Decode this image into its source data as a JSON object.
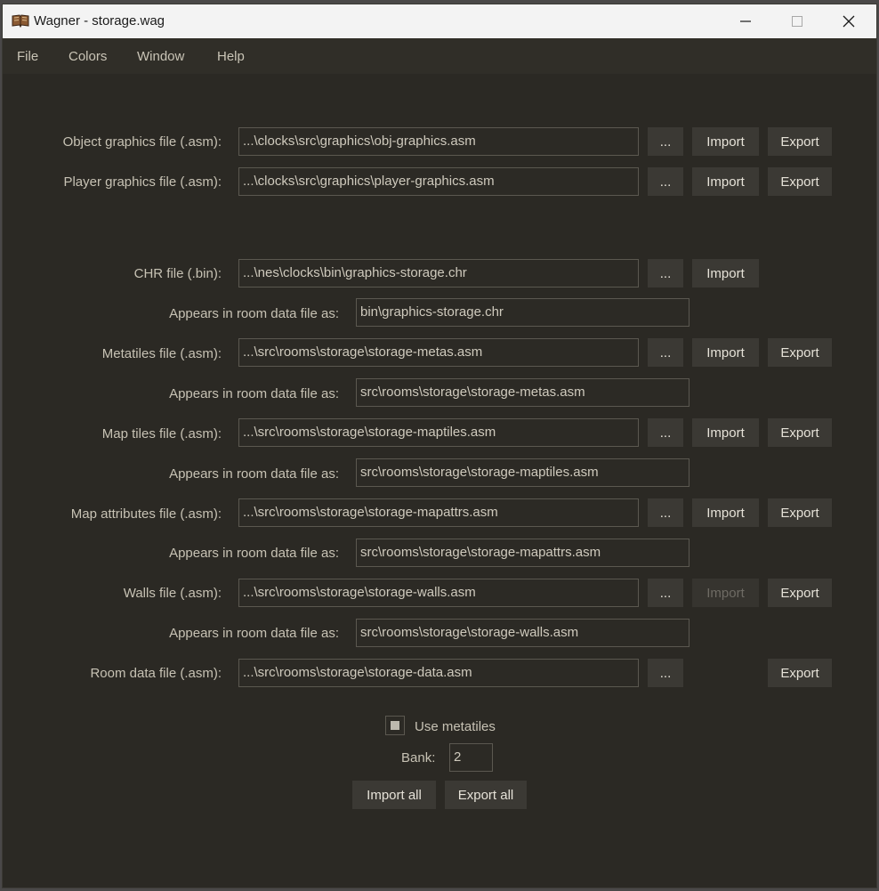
{
  "window": {
    "title": "Wagner - storage.wag"
  },
  "menu": [
    "File",
    "Colors",
    "Window",
    "Help"
  ],
  "buttons": {
    "browse": "...",
    "import": "Import",
    "export": "Export"
  },
  "rows": [
    {
      "label": "Object graphics file (.asm):",
      "value": "...\\clocks\\src\\graphics\\obj-graphics.asm"
    },
    {
      "label": "Player graphics file (.asm):",
      "value": "...\\clocks\\src\\graphics\\player-graphics.asm"
    },
    {
      "label": "CHR file (.bin):",
      "value": "...\\nes\\clocks\\bin\\graphics-storage.chr"
    },
    {
      "label": "Appears in room data file as:",
      "value": "bin\\graphics-storage.chr"
    },
    {
      "label": "Metatiles file (.asm):",
      "value": "...\\src\\rooms\\storage\\storage-metas.asm"
    },
    {
      "label": "Appears in room data file as:",
      "value": "src\\rooms\\storage\\storage-metas.asm"
    },
    {
      "label": "Map tiles file (.asm):",
      "value": "...\\src\\rooms\\storage\\storage-maptiles.asm"
    },
    {
      "label": "Appears in room data file as:",
      "value": "src\\rooms\\storage\\storage-maptiles.asm"
    },
    {
      "label": "Map attributes file (.asm):",
      "value": "...\\src\\rooms\\storage\\storage-mapattrs.asm"
    },
    {
      "label": "Appears in room data file as:",
      "value": "src\\rooms\\storage\\storage-mapattrs.asm"
    },
    {
      "label": "Walls file (.asm):",
      "value": "...\\src\\rooms\\storage\\storage-walls.asm"
    },
    {
      "label": "Appears in room data file as:",
      "value": "src\\rooms\\storage\\storage-walls.asm"
    },
    {
      "label": "Room data file (.asm):",
      "value": "...\\src\\rooms\\storage\\storage-data.asm"
    }
  ],
  "options": {
    "use_metatiles_label": "Use metatiles",
    "use_metatiles_checked": true,
    "bank_label": "Bank:",
    "bank_value": "2"
  },
  "actions": {
    "import_all": "Import all",
    "export_all": "Export all"
  },
  "colors": {
    "background": "#2b2924",
    "menubar": "#302e28",
    "button": "#3b3934",
    "field_border": "#5b5850",
    "text": "#c7c2b4"
  }
}
